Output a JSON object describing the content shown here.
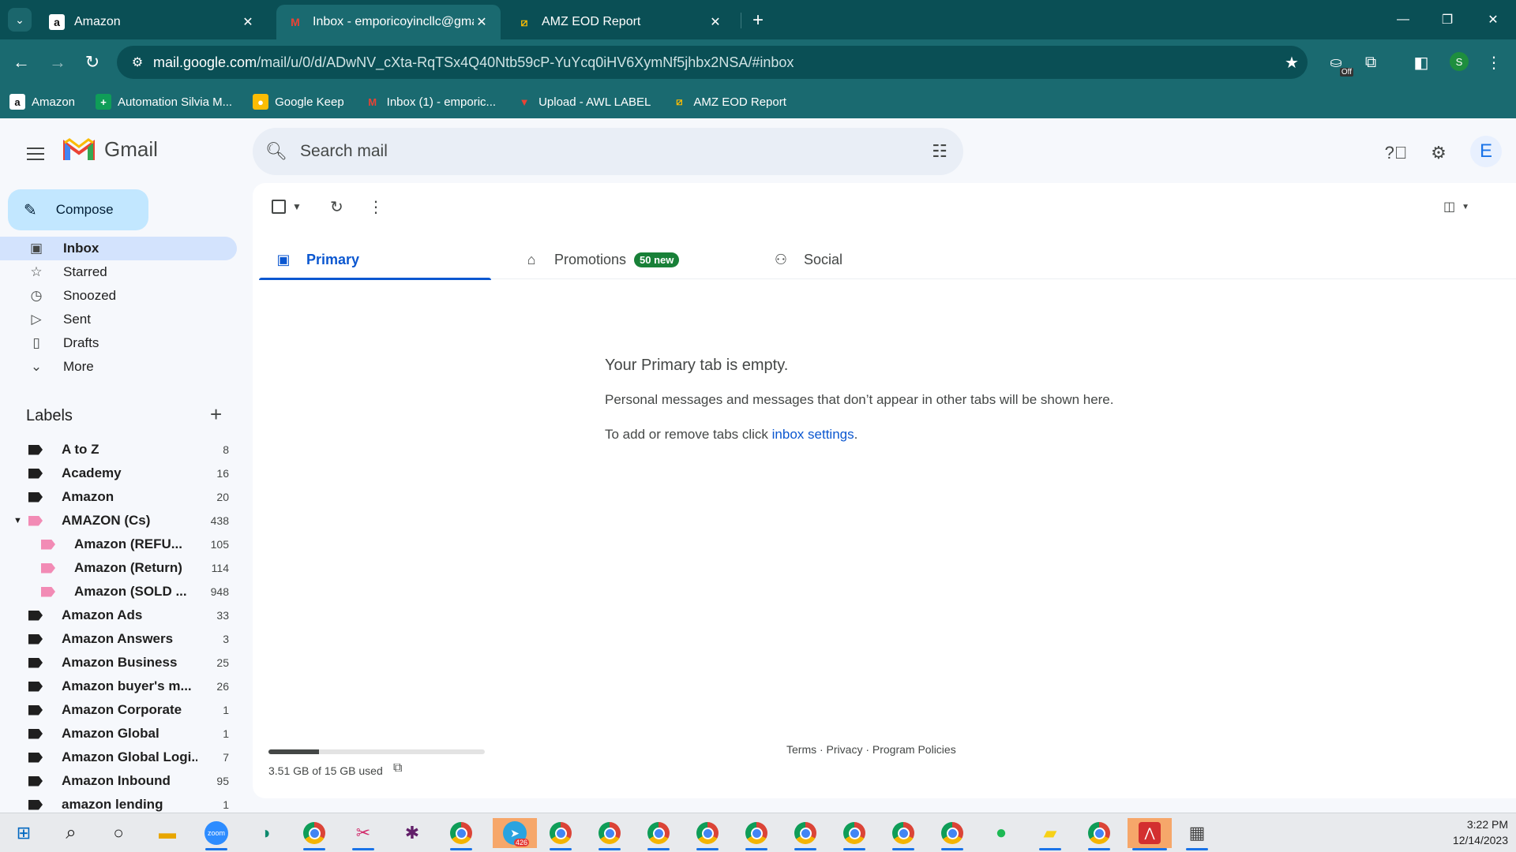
{
  "browser": {
    "tabs": [
      {
        "title": "Amazon",
        "favicon": "amazon-icon"
      },
      {
        "title": "Inbox - emporicoyincllc@gmail.",
        "favicon": "gmail-icon",
        "active": true
      },
      {
        "title": "AMZ EOD Report",
        "favicon": "report-icon"
      }
    ],
    "url_host": "mail.google.com",
    "url_path": "/mail/u/0/d/ADwNV_cXta-RqTSx4Q40Ntb59cP-YuYcq0iHV6XymNf5jhbx2NSA/#inbox",
    "extension_badge": "Off",
    "profile_initial": "S",
    "bookmarks": [
      {
        "label": "Amazon",
        "icon": "amazon-icon"
      },
      {
        "label": "Automation Silvia M...",
        "icon": "sheets-icon"
      },
      {
        "label": "Google Keep",
        "icon": "keep-icon"
      },
      {
        "label": "Inbox (1) - emporic...",
        "icon": "gmail-icon"
      },
      {
        "label": "Upload - AWL LABEL",
        "icon": "upload-icon"
      },
      {
        "label": "AMZ EOD Report",
        "icon": "report-icon"
      }
    ]
  },
  "gmail": {
    "wordmark": "Gmail",
    "search_placeholder": "Search mail",
    "avatar_initial": "E",
    "compose_label": "Compose",
    "nav": [
      {
        "label": "Inbox",
        "icon": "inbox-icon",
        "active": true
      },
      {
        "label": "Starred",
        "icon": "star-icon"
      },
      {
        "label": "Snoozed",
        "icon": "clock-icon"
      },
      {
        "label": "Sent",
        "icon": "send-icon"
      },
      {
        "label": "Drafts",
        "icon": "draft-icon"
      },
      {
        "label": "More",
        "icon": "chevron-down-icon"
      }
    ],
    "labels_heading": "Labels",
    "labels": [
      {
        "name": "A to Z",
        "count": "8"
      },
      {
        "name": "Academy",
        "count": "16"
      },
      {
        "name": "Amazon",
        "count": "20"
      },
      {
        "name": "AMAZON (Cs)",
        "count": "438",
        "color": "#f28bb5",
        "expanded": true
      },
      {
        "name": "Amazon (REFU...",
        "count": "105",
        "color": "#f28bb5",
        "child": true
      },
      {
        "name": "Amazon (Return)",
        "count": "114",
        "color": "#f28bb5",
        "child": true
      },
      {
        "name": "Amazon (SOLD ...",
        "count": "948",
        "color": "#f28bb5",
        "child": true
      },
      {
        "name": "Amazon Ads",
        "count": "33"
      },
      {
        "name": "Amazon Answers",
        "count": "3"
      },
      {
        "name": "Amazon Business",
        "count": "25"
      },
      {
        "name": "Amazon buyer's m...",
        "count": "26"
      },
      {
        "name": "Amazon Corporate",
        "count": "1"
      },
      {
        "name": "Amazon Global",
        "count": "1"
      },
      {
        "name": "Amazon Global Logi...",
        "count": "7"
      },
      {
        "name": "Amazon Inbound",
        "count": "95"
      },
      {
        "name": "amazon lending",
        "count": "1"
      }
    ],
    "tabs": {
      "primary": "Primary",
      "promotions": "Promotions",
      "promotions_badge": "50 new",
      "social": "Social"
    },
    "empty": {
      "title": "Your Primary tab is empty.",
      "message": "Personal messages and messages that don’t appear in other tabs will be shown here.",
      "settings_prefix": "To add or remove tabs click ",
      "settings_link": "inbox settings",
      "settings_suffix": "."
    },
    "storage": {
      "text": "3.51 GB of 15 GB used",
      "used_fraction": 0.234
    },
    "footer": "Terms · Privacy · Program Policies"
  },
  "taskbar": {
    "time": "3:22 PM",
    "date": "12/14/2023",
    "telegram_badge": "426",
    "zoom_label": "zoom"
  },
  "colors": {
    "chrome_dark": "#0a4f55",
    "chrome": "#1a6a70",
    "accent_blue": "#0b57d0",
    "compose": "#c2e7ff",
    "inbox_active": "#d3e3fd",
    "badge_green": "#188038",
    "label_pink": "#f28bb5"
  }
}
